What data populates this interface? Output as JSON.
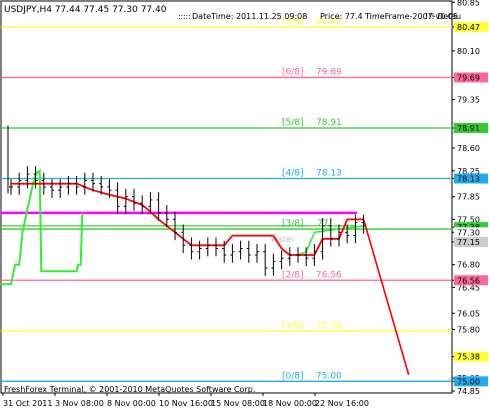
{
  "chart_data": {
    "type": "candlestick",
    "title": "USDJPY,H4  77.44 77.45 77.30 77.40",
    "header_info": {
      "marker": ":::::",
      "datetime_text": "DateTime: 2011.11.25 09:08",
      "price_text": "Price: 77.4",
      "timeframe_text": "TimeFrame-2007-v0.05",
      "more_text": "!!! Defau"
    },
    "footer": "FreshForex Terminal, © 2001-2010 MetaQuotes Software Corp.",
    "ylim": [
      74.82,
      80.87
    ],
    "y_ticks": [
      80.85,
      80.47,
      80.1,
      79.69,
      79.35,
      78.91,
      78.6,
      78.25,
      78.13,
      77.85,
      77.5,
      77.38,
      77.3,
      77.15,
      76.8,
      76.56,
      76.45,
      76.05,
      75.8,
      75.38,
      75.05,
      75.0,
      74.85
    ],
    "y_tick_labels": [
      "80.85",
      "80.47",
      "80.10",
      "79.69",
      "79.35",
      "78.91",
      "78.60",
      "78.25",
      "78.13",
      "77.85",
      "77.50",
      "77.38",
      "77.30",
      "77.15",
      "76.80",
      "76.56",
      "76.45",
      "76.05",
      "75.80",
      "75.38",
      "75.05",
      "75.00",
      "74.85"
    ],
    "highlighted_ticks": [
      {
        "value": 80.47,
        "label": "80.47",
        "color": "#ffff33"
      },
      {
        "value": 79.69,
        "label": "79.69",
        "color": "#ff6699"
      },
      {
        "value": 78.91,
        "label": "78.91",
        "color": "#33cc33"
      },
      {
        "value": 78.13,
        "label": "78.13",
        "color": "#22aaee"
      },
      {
        "value": 77.38,
        "label": "77.38",
        "color": "#33cc33"
      },
      {
        "value": 77.3,
        "label": "77.30",
        "color": "#ffffff"
      },
      {
        "value": 77.15,
        "label": "77.15",
        "color": "#cccccc"
      },
      {
        "value": 76.56,
        "label": "76.56",
        "color": "#ff6699"
      },
      {
        "value": 75.38,
        "label": "75.38",
        "color": "#ffff33"
      },
      {
        "value": 75.0,
        "label": "75.00",
        "color": "#22aaee"
      }
    ],
    "x_labels": [
      "31 Oct 2011",
      "3 Nov 08:00",
      "8 Nov 00:00",
      "10 Nov 16:00",
      "15 Nov 08:00",
      "18 Nov 00:00",
      "22 Nov 16:00"
    ],
    "murrey_levels": [
      {
        "name": "[7/8]",
        "value": 80.47,
        "color": "#ffff33"
      },
      {
        "name": "[6/8]",
        "value": 79.69,
        "color": "#ff6699"
      },
      {
        "name": "[5/8]",
        "value": 78.91,
        "color": "#33cc33"
      },
      {
        "name": "[4/8]",
        "value": 78.13,
        "color": "#22aaee"
      },
      {
        "name": "[3/8]",
        "value": 77.35,
        "color": "#33cc33"
      },
      {
        "name": "[2/8]",
        "value": 76.56,
        "color": "#ff6699"
      },
      {
        "name": "[1/8]",
        "value": 75.78,
        "color": "#ffff33"
      },
      {
        "name": "[0/8]",
        "value": 75.0,
        "color": "#22aaee"
      }
    ],
    "murrey_value_labels": [
      "80.47",
      "79.69",
      "78.91",
      "78.13",
      "77.35",
      "76.56",
      "75.78",
      "75.00"
    ],
    "partial_labels": {
      "level3": "77.",
      "yesterday": "Yester"
    },
    "magenta_level": 77.6,
    "green_level": 77.4,
    "close_series": [
      78.0,
      78.1,
      78.2,
      78.1,
      78.0,
      77.95,
      78.0,
      78.05,
      78.0,
      78.1,
      78.05,
      78.0,
      77.95,
      77.7,
      77.85,
      77.75,
      77.7,
      77.8,
      77.6,
      77.5,
      77.3,
      77.1,
      77.0,
      77.05,
      77.1,
      77.05,
      76.95,
      77.0,
      77.05,
      76.95,
      77.0,
      76.75,
      76.85,
      76.9,
      76.95,
      76.95,
      76.9,
      77.0,
      77.4,
      77.2,
      77.3,
      77.25,
      77.45,
      77.4
    ],
    "red_line": [
      [
        0,
        78.05
      ],
      [
        8,
        78.05
      ],
      [
        10,
        77.95
      ],
      [
        12,
        77.88
      ],
      [
        14,
        77.82
      ],
      [
        16,
        77.72
      ],
      [
        17,
        77.62
      ],
      [
        18,
        77.5
      ],
      [
        20,
        77.3
      ],
      [
        21,
        77.2
      ],
      [
        22,
        77.1
      ],
      [
        26,
        77.1
      ],
      [
        27,
        77.25
      ],
      [
        32,
        77.25
      ],
      [
        33,
        77.05
      ],
      [
        34,
        76.95
      ],
      [
        37,
        76.95
      ],
      [
        38,
        77.2
      ],
      [
        40,
        77.2
      ],
      [
        41,
        77.5
      ],
      [
        43,
        77.5
      ]
    ],
    "red_projection": [
      [
        43,
        77.5
      ],
      [
        48.5,
        75.1
      ]
    ],
    "green_line": [
      [
        -1.5,
        76.5
      ],
      [
        0,
        76.5
      ],
      [
        0.5,
        76.8
      ],
      [
        1,
        76.8
      ],
      [
        1.4,
        77.3
      ],
      [
        2,
        77.65
      ],
      [
        2.6,
        78.0
      ],
      [
        3,
        78.2
      ],
      [
        3.5,
        78.25
      ],
      [
        3.7,
        76.7
      ],
      [
        8,
        76.7
      ],
      [
        8.2,
        76.8
      ],
      [
        8.5,
        76.8
      ],
      [
        8.7,
        77.6
      ]
    ],
    "green_line2": [
      [
        35,
        76.95
      ],
      [
        36,
        77.0
      ],
      [
        37,
        77.3
      ],
      [
        43,
        77.4
      ]
    ]
  }
}
